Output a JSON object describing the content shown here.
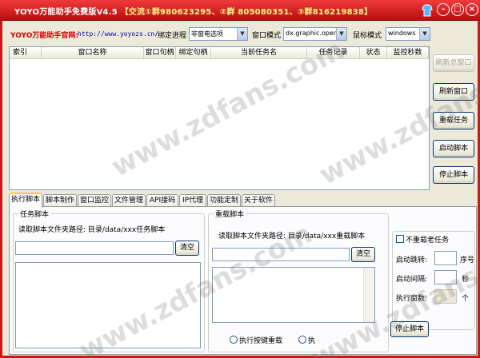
{
  "titlebar": {
    "app": "YOYO万能助手免费版V4.5",
    "info": "【交流①群980623295、②群 805080351、③群816219838】",
    "minimize": "–",
    "maximize": "□",
    "close": "×"
  },
  "toolbar": {
    "site_label": "YOYO万能助手官网:",
    "site_url": "http://www.yoyozs.cn/",
    "bind_process_label": "绑定进程",
    "bind_process_value": "非窗电选项",
    "window_mode_label": "窗口模式",
    "window_mode_value": "dx.graphic.open",
    "mouse_mode_label": "鼠标模式",
    "mouse_mode_value": "windows"
  },
  "list": {
    "columns": [
      "索引",
      "窗口名称",
      "窗口句柄",
      "绑定句柄",
      "当前任务名",
      "任务记录",
      "状态",
      "监控秒数"
    ]
  },
  "side_buttons": {
    "refresh_all": "刷新总窗口",
    "refresh": "刷新窗口",
    "reload_task": "重载任务",
    "start_script": "启动脚本",
    "stop_script": "停止脚本"
  },
  "tabs": [
    "执行脚本",
    "脚本制作",
    "窗口监控",
    "文件管理",
    "API接码",
    "IP代理",
    "功能定制",
    "关于软件"
  ],
  "task_script": {
    "title": "任务脚本",
    "path_label": "读取脚本文件夹路径: 目录/data/xxx任务脚本",
    "clear": "清空"
  },
  "reload_script": {
    "title": "重载脚本",
    "path_label": "读取脚本文件夹路径: 目录/data/xxx重载脚本",
    "clear": "清空",
    "radio1": "执行按键重载",
    "radio2": "执"
  },
  "options": {
    "no_reload_old": "不重载老任务",
    "start_jump": "启动跳转:",
    "seq_unit": "序号",
    "start_interval": "启动间隔:",
    "sec_unit": "秒",
    "exec_windows": "执行窗数:",
    "win_unit": "个",
    "stop_script": "停止脚本"
  },
  "watermark": "www.zdfans.com"
}
